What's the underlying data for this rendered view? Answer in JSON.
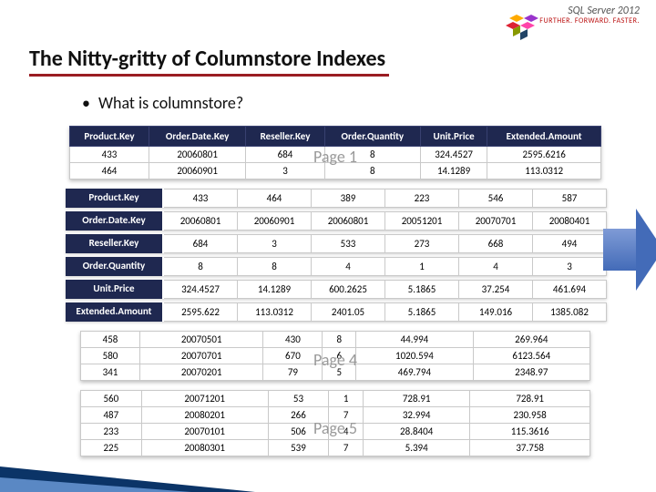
{
  "brand": {
    "main": "SQL Server 2012",
    "sub": "FURTHER. FORWARD. FASTER."
  },
  "title": "The Nitty-gritty of Columnstore Indexes",
  "bullet": "What is columnstore?",
  "panel1": {
    "watermark": "Page 1",
    "headers": [
      "Product.Key",
      "Order.Date.Key",
      "Reseller.Key",
      "Order.Quantity",
      "Unit.Price",
      "Extended.Amount"
    ],
    "rows": [
      [
        "433",
        "20060801",
        "684",
        "8",
        "324.4527",
        "2595.6216"
      ],
      [
        "464",
        "20060901",
        "3",
        "8",
        "14.1289",
        "113.0312"
      ]
    ]
  },
  "panel2": {
    "rows": [
      {
        "label": "Product.Key",
        "values": [
          "433",
          "464",
          "389",
          "223",
          "546",
          "587"
        ]
      },
      {
        "label": "Order.Date.Key",
        "values": [
          "20060801",
          "20060901",
          "20060801",
          "20051201",
          "20070701",
          "20080401"
        ]
      },
      {
        "label": "Reseller.Key",
        "values": [
          "684",
          "3",
          "533",
          "273",
          "668",
          "494"
        ]
      },
      {
        "label": "Order.Quantity",
        "values": [
          "8",
          "8",
          "4",
          "1",
          "4",
          "3"
        ]
      },
      {
        "label": "Unit.Price",
        "values": [
          "324.4527",
          "14.1289",
          "600.2625",
          "5.1865",
          "37.254",
          "461.694"
        ]
      },
      {
        "label": "Extended.Amount",
        "values": [
          "2595.622",
          "113.0312",
          "2401.05",
          "5.1865",
          "149.016",
          "1385.082"
        ]
      }
    ]
  },
  "panel3": {
    "watermark": "Page 4",
    "rows": [
      [
        "458",
        "20070501",
        "430",
        "8",
        "44.994",
        "269.964"
      ],
      [
        "580",
        "20070701",
        "670",
        "6",
        "1020.594",
        "6123.564"
      ],
      [
        "341",
        "20070201",
        "79",
        "5",
        "469.794",
        "2348.97"
      ]
    ]
  },
  "panel4": {
    "watermark": "Page 5",
    "rows": [
      [
        "560",
        "20071201",
        "53",
        "1",
        "728.91",
        "728.91"
      ],
      [
        "487",
        "20080201",
        "266",
        "7",
        "32.994",
        "230.958"
      ],
      [
        "233",
        "20070101",
        "506",
        "4",
        "28.8404",
        "115.3616"
      ],
      [
        "225",
        "20080301",
        "539",
        "7",
        "5.394",
        "37.758"
      ]
    ]
  }
}
